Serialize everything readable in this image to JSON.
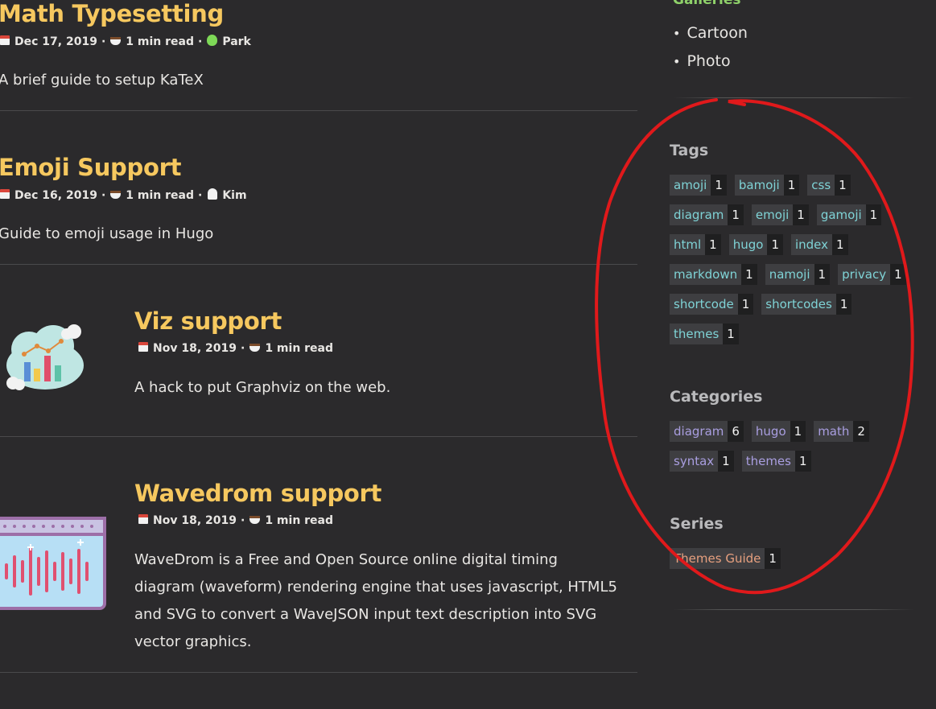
{
  "posts": [
    {
      "title": "Math Typesetting",
      "date": "Dec 17, 2019",
      "read_time": "1 min read",
      "author": "Park",
      "summary": "A brief guide to setup KaTeX"
    },
    {
      "title": "Emoji Support",
      "date": "Dec 16, 2019",
      "read_time": "1 min read",
      "author": "Kim",
      "summary": "Guide to emoji usage in Hugo"
    },
    {
      "title": "Viz support",
      "date": "Nov 18, 2019",
      "read_time": "1 min read",
      "summary": "A hack to put Graphviz on the web.",
      "thumbnail": "cloud-chart-illustration"
    },
    {
      "title": "Wavedrom support",
      "date": "Nov 18, 2019",
      "read_time": "1 min read",
      "summary_lines": [
        "WaveDrom is a Free and Open Source online digital timing",
        "diagram (waveform) rendering engine that uses javascript, HTML5",
        "and SVG to convert a WaveJSON input text description into SVG",
        "vector graphics."
      ],
      "thumbnail": "waveform-illustration"
    }
  ],
  "sidebar": {
    "galleries": {
      "title": "Galleries",
      "items": [
        "Cartoon",
        "Photo"
      ]
    },
    "tags": {
      "title": "Tags",
      "items": [
        {
          "name": "amoji",
          "count": "1"
        },
        {
          "name": "bamoji",
          "count": "1"
        },
        {
          "name": "css",
          "count": "1"
        },
        {
          "name": "diagram",
          "count": "1"
        },
        {
          "name": "emoji",
          "count": "1"
        },
        {
          "name": "gamoji",
          "count": "1"
        },
        {
          "name": "html",
          "count": "1"
        },
        {
          "name": "hugo",
          "count": "1"
        },
        {
          "name": "index",
          "count": "1"
        },
        {
          "name": "markdown",
          "count": "1"
        },
        {
          "name": "namoji",
          "count": "1"
        },
        {
          "name": "privacy",
          "count": "1"
        },
        {
          "name": "shortcode",
          "count": "1"
        },
        {
          "name": "shortcodes",
          "count": "1"
        },
        {
          "name": "themes",
          "count": "1"
        }
      ]
    },
    "categories": {
      "title": "Categories",
      "items": [
        {
          "name": "diagram",
          "count": "6"
        },
        {
          "name": "hugo",
          "count": "1"
        },
        {
          "name": "math",
          "count": "2"
        },
        {
          "name": "syntax",
          "count": "1"
        },
        {
          "name": "themes",
          "count": "1"
        }
      ]
    },
    "series": {
      "title": "Series",
      "items": [
        {
          "name": "Themes Guide",
          "count": "1"
        }
      ]
    }
  },
  "icons": {
    "date": "calendar-icon",
    "read_time": "coffee-cup-icon",
    "author_park": "alien-icon",
    "author_kim": "ghost-icon"
  },
  "colors": {
    "background": "#2b2a2c",
    "title": "#f6c85f",
    "tag_text": "#7fd3d6",
    "category_text": "#a99ee0",
    "series_text": "#e7a07f",
    "annotation": "#e0191b"
  }
}
